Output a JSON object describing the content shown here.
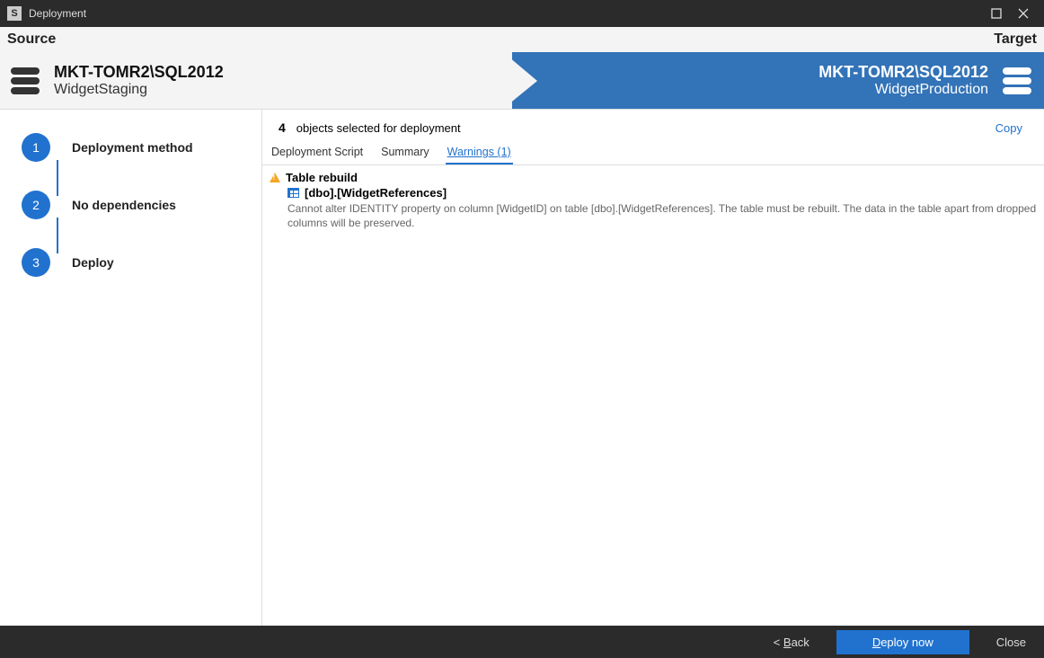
{
  "titlebar": {
    "title": "Deployment"
  },
  "header": {
    "source_label": "Source",
    "target_label": "Target"
  },
  "source": {
    "server": "MKT-TOMR2\\SQL2012",
    "database": "WidgetStaging"
  },
  "target": {
    "server": "MKT-TOMR2\\SQL2012",
    "database": "WidgetProduction"
  },
  "steps": [
    {
      "num": "1",
      "label": "Deployment method"
    },
    {
      "num": "2",
      "label": "No dependencies"
    },
    {
      "num": "3",
      "label": "Deploy"
    }
  ],
  "content": {
    "selected_count": "4",
    "selected_text": "objects selected for deployment",
    "copy_label": "Copy"
  },
  "tabs": [
    {
      "label": "Deployment Script",
      "active": false
    },
    {
      "label": "Summary",
      "active": false
    },
    {
      "label": "Warnings (1)",
      "active": true
    }
  ],
  "warnings": {
    "heading": "Table rebuild",
    "object": "[dbo].[WidgetReferences]",
    "message": "Cannot alter IDENTITY property on column [WidgetID] on table [dbo].[WidgetReferences]. The table must be rebuilt. The data in the table apart from dropped columns will be preserved."
  },
  "footer": {
    "back_prefix": "< ",
    "back_u": "B",
    "back_rest": "ack",
    "deploy_u": "D",
    "deploy_rest": "eploy now",
    "close": "Close"
  }
}
